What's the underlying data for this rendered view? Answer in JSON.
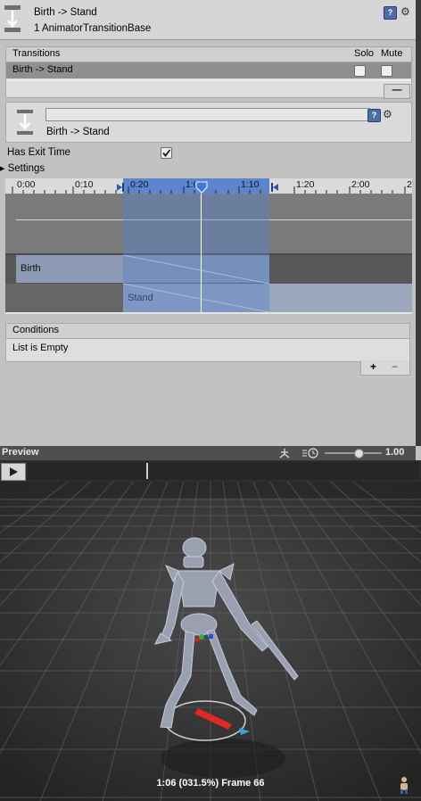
{
  "header": {
    "title": "Birth -> Stand",
    "subtitle": "1 AnimatorTransitionBase"
  },
  "transitions": {
    "heading": "Transitions",
    "solo_label": "Solo",
    "mute_label": "Mute",
    "rows": [
      {
        "label": "Birth -> Stand",
        "solo": false,
        "mute": false
      }
    ],
    "remove_label": "—"
  },
  "transition_detail": {
    "name_value": "",
    "label": "Birth -> Stand"
  },
  "has_exit_time": {
    "label": "Has Exit Time",
    "checked": true
  },
  "settings": {
    "label": "Settings",
    "expanded": false
  },
  "timeline": {
    "ticks": [
      "0:00",
      "0:10",
      "0:20",
      "1:00",
      "1:10",
      "1:20",
      "2:00",
      "2"
    ],
    "clips": {
      "source": "Birth",
      "destination": "Stand"
    }
  },
  "conditions": {
    "heading": "Conditions",
    "empty_text": "List is Empty",
    "add_label": "+",
    "remove_label": "−"
  },
  "preview": {
    "label": "Preview",
    "speed_value": "1.00",
    "status": "1:06 (031.5%) Frame 66",
    "speed_level": 0.6
  },
  "colors": {
    "timeline_selection": "#5b86cf",
    "preview_bar": "#4f4f4f",
    "viewport": "#3b3b3b"
  }
}
